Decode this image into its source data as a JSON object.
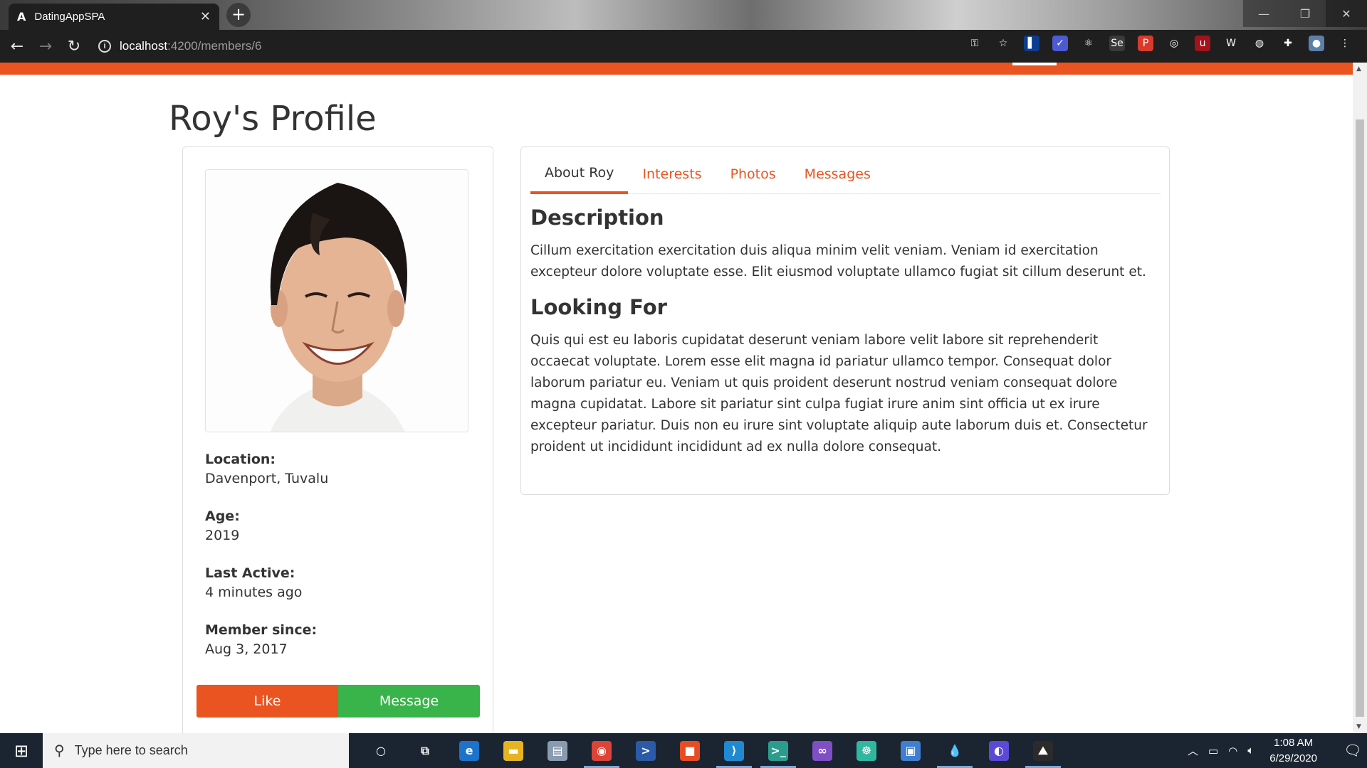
{
  "browser": {
    "tab_title": "DatingAppSPA",
    "tab_favicon": "A",
    "url_host": "localhost",
    "url_path": ":4200/members/6",
    "extensions": [
      {
        "name": "key-icon",
        "color": "#1f1f1f",
        "glyph": "⚿"
      },
      {
        "name": "star-icon",
        "color": "#1f1f1f",
        "glyph": "☆"
      },
      {
        "name": "flag-extension-icon",
        "color": "#0a3d91",
        "glyph": "▌"
      },
      {
        "name": "checkmark-extension-icon",
        "color": "#4c5bd4",
        "glyph": "✓"
      },
      {
        "name": "react-devtools-icon",
        "color": "#1f1f1f",
        "glyph": "⚛"
      },
      {
        "name": "selenium-extension-icon",
        "color": "#3a3a3a",
        "glyph": "Se"
      },
      {
        "name": "pdf-extension-icon",
        "color": "#d83b2b",
        "glyph": "P"
      },
      {
        "name": "target-extension-icon",
        "color": "#1f1f1f",
        "glyph": "◎"
      },
      {
        "name": "ublock-icon",
        "color": "#a2131b",
        "glyph": "u"
      },
      {
        "name": "wappalyzer-icon",
        "color": "#1f1f1f",
        "glyph": "W"
      },
      {
        "name": "globe-extension-icon",
        "color": "#1f1f1f",
        "glyph": "◍"
      },
      {
        "name": "puzzle-extensions-icon",
        "color": "#1f1f1f",
        "glyph": "✚"
      },
      {
        "name": "profile-avatar-icon",
        "color": "#5d7fa8",
        "glyph": "●"
      },
      {
        "name": "menu-kebab-icon",
        "color": "#1f1f1f",
        "glyph": "⋮"
      }
    ]
  },
  "page": {
    "title": "Roy's Profile"
  },
  "profile": {
    "fields": [
      {
        "label": "Location:",
        "value": "Davenport, Tuvalu"
      },
      {
        "label": "Age:",
        "value": "2019"
      },
      {
        "label": "Last Active:",
        "value": "4 minutes ago"
      },
      {
        "label": "Member since:",
        "value": "Aug 3, 2017"
      }
    ],
    "like_label": "Like",
    "message_label": "Message"
  },
  "tabs": {
    "about": "About Roy",
    "interests": "Interests",
    "photos": "Photos",
    "messages": "Messages"
  },
  "about": {
    "description_heading": "Description",
    "description_text": "Cillum exercitation exercitation duis aliqua minim velit veniam. Veniam id exercitation excepteur dolore voluptate esse. Elit eiusmod voluptate ullamco fugiat sit cillum deserunt et.",
    "looking_heading": "Looking For",
    "looking_text": "Quis qui est eu laboris cupidatat deserunt veniam labore velit labore sit reprehenderit occaecat voluptate. Lorem esse elit magna id pariatur ullamco tempor. Consequat dolor laborum pariatur eu. Veniam ut quis proident deserunt nostrud veniam consequat dolore magna cupidatat. Labore sit pariatur sint culpa fugiat irure anim sint officia ut ex irure excepteur pariatur. Duis non eu irure sint voluptate aliquip aute laborum duis et. Consectetur proident ut incididunt incididunt ad ex nulla dolore consequat."
  },
  "taskbar": {
    "search_placeholder": "Type here to search",
    "time": "1:08 AM",
    "date": "6/29/2020",
    "apps": [
      {
        "name": "cortana-icon",
        "glyph": "○",
        "color": "transparent",
        "running": false
      },
      {
        "name": "task-view-icon",
        "glyph": "⧉",
        "color": "transparent",
        "running": false
      },
      {
        "name": "edge-icon",
        "glyph": "e",
        "color": "#1d73c9",
        "running": false
      },
      {
        "name": "file-explorer-icon",
        "glyph": "▬",
        "color": "#e6b422",
        "running": false
      },
      {
        "name": "printer-app-icon",
        "glyph": "▤",
        "color": "#8a9bb0",
        "running": false
      },
      {
        "name": "chrome-icon",
        "glyph": "◉",
        "color": "#db4437",
        "running": true
      },
      {
        "name": "powershell-icon",
        "glyph": ">",
        "color": "#2a5aa8",
        "running": false
      },
      {
        "name": "office-icon",
        "glyph": "■",
        "color": "#e84c22",
        "running": false
      },
      {
        "name": "vscode-icon",
        "glyph": "⟩",
        "color": "#1f8ad2",
        "running": true
      },
      {
        "name": "terminal-icon",
        "glyph": ">_",
        "color": "#2a9d8f",
        "running": true
      },
      {
        "name": "visual-studio-icon",
        "glyph": "∞",
        "color": "#7f4fc4",
        "running": false
      },
      {
        "name": "gitkraken-icon",
        "glyph": "☸",
        "color": "#2fb8a0",
        "running": false
      },
      {
        "name": "remote-desktop-icon",
        "glyph": "▣",
        "color": "#3f7fd1",
        "running": false
      },
      {
        "name": "droplet-app-icon",
        "glyph": "💧",
        "color": "transparent",
        "running": true
      },
      {
        "name": "moon-app-icon",
        "glyph": "◐",
        "color": "#5b4ad6",
        "running": false
      },
      {
        "name": "photos-app-icon",
        "glyph": "⛰",
        "color": "#2b2b2b",
        "running": true
      }
    ]
  }
}
